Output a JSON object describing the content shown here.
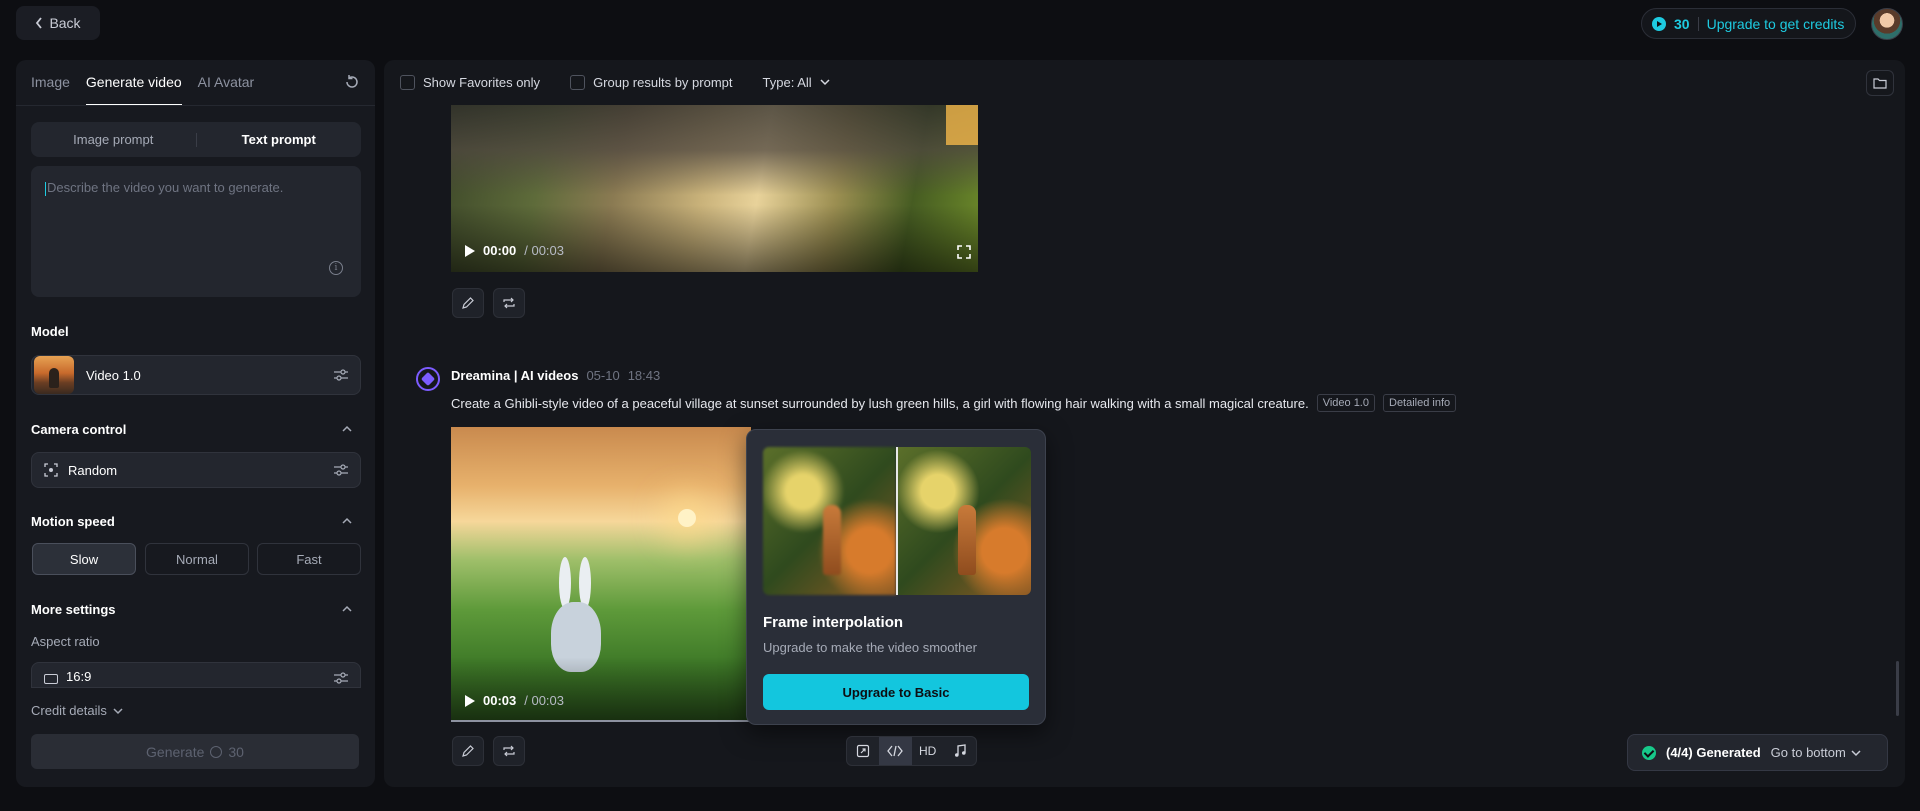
{
  "topbar": {
    "back_label": "Back",
    "credits": "30",
    "upgrade_label": "Upgrade to get credits"
  },
  "left": {
    "tabs": [
      {
        "label": "Image",
        "active": false
      },
      {
        "label": "Generate video",
        "active": true
      },
      {
        "label": "AI Avatar",
        "active": false
      }
    ],
    "prompt_modes": [
      {
        "label": "Image prompt",
        "active": false
      },
      {
        "label": "Text prompt",
        "active": true
      }
    ],
    "prompt_placeholder": "Describe the video you want to generate.",
    "model": {
      "title": "Model",
      "value": "Video 1.0"
    },
    "camera": {
      "title": "Camera control",
      "value": "Random"
    },
    "motion": {
      "title": "Motion speed",
      "options": [
        {
          "label": "Slow",
          "active": true
        },
        {
          "label": "Normal",
          "active": false
        },
        {
          "label": "Fast",
          "active": false
        }
      ]
    },
    "more": {
      "title": "More settings",
      "aspect_label": "Aspect ratio",
      "aspect_value": "16:9"
    },
    "credit_details": "Credit details",
    "generate": {
      "label": "Generate",
      "cost": "30"
    }
  },
  "toolbar": {
    "favorites": "Show Favorites only",
    "group": "Group results by prompt",
    "type": "Type: All"
  },
  "video1": {
    "current": "00:00",
    "total": "/ 00:03"
  },
  "message": {
    "author": "Dreamina | AI videos",
    "date": "05-10",
    "time": "18:43",
    "prompt": "Create a Ghibli-style video of a peaceful village at sunset surrounded by lush green hills, a girl with flowing hair walking with a small magical creature.",
    "tag_model": "Video 1.0",
    "tag_info": "Detailed info"
  },
  "video2": {
    "current": "00:03",
    "total": "/ 00:03"
  },
  "popup": {
    "title": "Frame interpolation",
    "subtitle": "Upgrade to make the video smoother",
    "button": "Upgrade to Basic"
  },
  "controls": {
    "hd": "HD"
  },
  "status": {
    "generated": "(4/4) Generated",
    "go_bottom": "Go to bottom"
  },
  "colors": {
    "accent": "#13c6de",
    "brand": "#7c5cff",
    "success": "#17c98a"
  }
}
